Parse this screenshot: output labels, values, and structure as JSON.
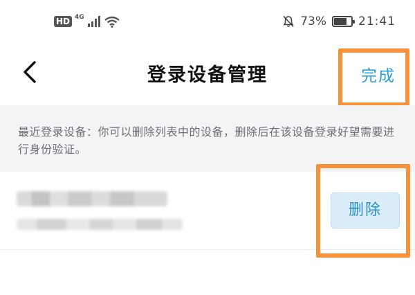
{
  "status_bar": {
    "hd_label": "HD",
    "network_label": "4G",
    "battery_percent": "73%",
    "battery_level": 0.73,
    "time": "21:41"
  },
  "nav": {
    "title": "登录设备管理",
    "done_label": "完成"
  },
  "info": {
    "text": "最近登录设备：你可以删除列表中的设备，删除后在该设备登录好望需要进行身份验证。"
  },
  "device_list": {
    "items": [
      {
        "delete_label": "删除"
      }
    ]
  },
  "colors": {
    "accent": "#2a9fd6",
    "highlight": "#f7923a",
    "info_background": "#f3f4f6",
    "delete_button_bg": "#d9ecf8"
  }
}
